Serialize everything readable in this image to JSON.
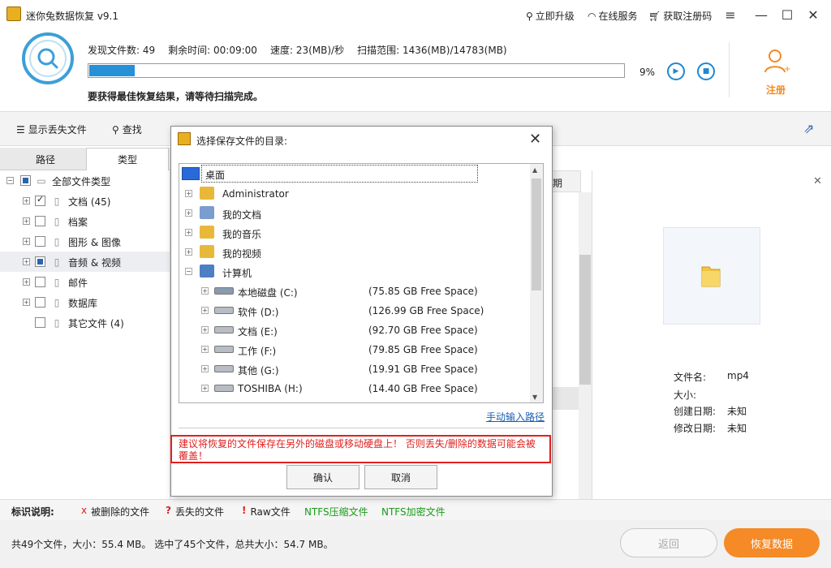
{
  "app": {
    "title": "迷你兔数据恢复  v9.1",
    "upgrade": "立即升级",
    "online_service": "在线服务",
    "get_code": "获取注册码"
  },
  "scan": {
    "found_label": "发现文件数:",
    "found_value": "49",
    "remaining_label": "剩余时间:",
    "remaining_value": "00:09:00",
    "speed_label": "速度:",
    "speed_value": "23(MB)/秒",
    "range_label": "扫描范围:",
    "range_value": "1436(MB)/14783(MB)",
    "progress_percent": 9,
    "progress_text": "9%",
    "hint": "要获得最佳恢复结果，请等待扫描完成。",
    "register": "注册"
  },
  "toolbar": {
    "show_lost": "显示丢失文件",
    "find": "查找"
  },
  "left": {
    "tab_path": "路径",
    "tab_type": "类型",
    "root": "全部文件类型",
    "items": [
      {
        "label": "文档 (45)",
        "state": "checked",
        "icon": "document-icon"
      },
      {
        "label": "档案",
        "state": "none",
        "icon": "archive-icon"
      },
      {
        "label": "图形 & 图像",
        "state": "none",
        "icon": "image-icon"
      },
      {
        "label": "音频 & 视频",
        "state": "partial",
        "icon": "media-icon"
      },
      {
        "label": "邮件",
        "state": "none",
        "icon": "mail-icon"
      },
      {
        "label": "数据库",
        "state": "none",
        "icon": "database-icon"
      },
      {
        "label": "其它文件 (4)",
        "state": "none",
        "icon": "folder-icon"
      }
    ]
  },
  "middle": {
    "header_fragment": "期"
  },
  "preview": {
    "filename_label": "文件名:",
    "filename_value": "mp4",
    "size_label": "大小:",
    "size_value": "",
    "created_label": "创建日期:",
    "created_value": "未知",
    "modified_label": "修改日期:",
    "modified_value": "未知"
  },
  "legend": {
    "title": "标识说明:",
    "deleted_mark": "x",
    "deleted": "被删除的文件",
    "lost_mark": "?",
    "lost": "丢失的文件",
    "raw_mark": "!",
    "raw": "Raw文件",
    "ntfs_comp": "NTFS压缩文件",
    "ntfs_enc": "NTFS加密文件"
  },
  "footer": {
    "summary": "共49个文件，大小：55.4 MB。  选中了45个文件，总共大小：54.7 MB。",
    "back": "返回",
    "recover": "恢复数据"
  },
  "dialog": {
    "title": "选择保存文件的目录:",
    "desktop": "桌面",
    "nodes": [
      {
        "label": "Administrator",
        "icon": "user-folder-icon"
      },
      {
        "label": "我的文档",
        "icon": "documents-icon"
      },
      {
        "label": "我的音乐",
        "icon": "music-folder-icon"
      },
      {
        "label": "我的视频",
        "icon": "video-folder-icon"
      },
      {
        "label": "计算机",
        "icon": "computer-icon"
      }
    ],
    "drives": [
      {
        "label": "本地磁盘 (C:)",
        "space": "(75.85 GB Free Space)"
      },
      {
        "label": "软件 (D:)",
        "space": "(126.99 GB Free Space)"
      },
      {
        "label": "文档 (E:)",
        "space": "(92.70 GB Free Space)"
      },
      {
        "label": "工作 (F:)",
        "space": "(79.85 GB Free Space)"
      },
      {
        "label": "其他 (G:)",
        "space": "(19.91 GB Free Space)"
      },
      {
        "label": "TOSHIBA (H:)",
        "space": "(14.40 GB Free Space)"
      }
    ],
    "manual_path": "手动输入路径",
    "warning": "建议将恢复的文件保存在另外的磁盘或移动硬盘上！ 否则丢失/删除的数据可能会被覆盖！",
    "ok": "确认",
    "cancel": "取消"
  },
  "colors": {
    "accent": "#2691d9",
    "orange": "#f58a26",
    "warning_red": "#e02020",
    "ntfs_green": "#1a9a1a"
  }
}
